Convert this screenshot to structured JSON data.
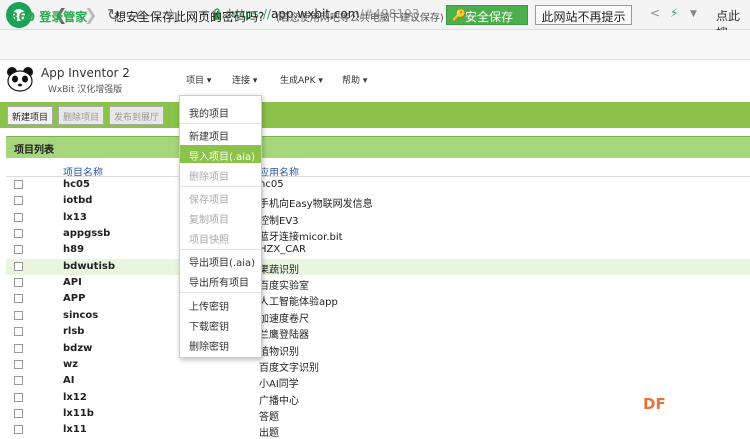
{
  "browser": {
    "url_scheme": "https://",
    "url_host": "app.wxbit.com",
    "url_hash": "/#498193",
    "right_text": "点此搜"
  },
  "password_bar": {
    "brand": "360 登录管家",
    "question": "想安全保存此网页的密码吗?",
    "note": "(若您使用网吧等公共电脑下建议保存)",
    "save_label": "安全保存",
    "never_label": "此网站不再提示"
  },
  "app": {
    "title": "App Inventor 2",
    "subtitle": "WxBit 汉化增强版",
    "menu": [
      "项目 ▾",
      "连接 ▾",
      "生成APK ▾",
      "帮助 ▾"
    ]
  },
  "toolbar": {
    "new_project": "新建项目",
    "delete_project": "删除项目",
    "publish": "发布到展厅"
  },
  "list": {
    "title": "项目列表",
    "col_name": "项目名称",
    "col_app": "应用名称",
    "rows": [
      {
        "name": "hc05",
        "app": "hc05"
      },
      {
        "name": "iotbd",
        "app": "手机向Easy物联网发信息"
      },
      {
        "name": "lx13",
        "app": "控制EV3"
      },
      {
        "name": "appgssb",
        "app": "蓝牙连接micor.bit"
      },
      {
        "name": "h89",
        "app": "HZX_CAR"
      },
      {
        "name": "bdwutisb",
        "app": "果蔬识别"
      },
      {
        "name": "API",
        "app": "百度实验室"
      },
      {
        "name": "APP",
        "app": "人工智能体验app"
      },
      {
        "name": "sincos",
        "app": "加速度卷尺"
      },
      {
        "name": "rlsb",
        "app": "兰鹰登陆器"
      },
      {
        "name": "bdzw",
        "app": "植物识别"
      },
      {
        "name": "wz",
        "app": "百度文字识别"
      },
      {
        "name": "AI",
        "app": "小AI同学"
      },
      {
        "name": "lx12",
        "app": "广播中心"
      },
      {
        "name": "lx11b",
        "app": "答题"
      },
      {
        "name": "lx11",
        "app": "出题"
      }
    ]
  },
  "dropdown": {
    "items": [
      {
        "label": "我的项目",
        "state": "normal"
      },
      {
        "label": "新建项目",
        "state": "normal"
      },
      {
        "label": "导入项目(.aia)",
        "state": "active"
      },
      {
        "label": "删除项目",
        "state": "disabled"
      },
      {
        "label": "保存项目",
        "state": "disabled"
      },
      {
        "label": "复制项目",
        "state": "disabled"
      },
      {
        "label": "项目快照",
        "state": "disabled"
      },
      {
        "label": "导出项目(.aia)",
        "state": "normal"
      },
      {
        "label": "导出所有项目",
        "state": "normal"
      },
      {
        "label": "上传密钥",
        "state": "normal"
      },
      {
        "label": "下载密钥",
        "state": "normal"
      },
      {
        "label": "删除密钥",
        "state": "normal"
      }
    ]
  },
  "watermark": "DF",
  "colors": {
    "accent_green": "#8bc34a",
    "header_green": "#a5d67b",
    "save_green": "#4cae4c"
  }
}
